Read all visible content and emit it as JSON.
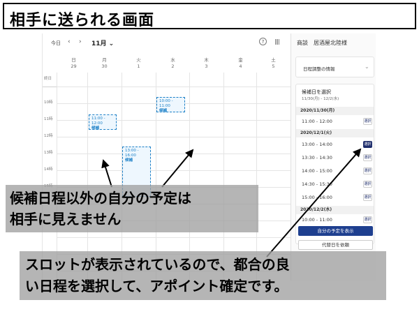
{
  "title": "相手に送られる画面",
  "calendar": {
    "today_label": "今日",
    "prev_icon": "‹",
    "next_icon": "›",
    "month_label": "11月 ⌄",
    "help_icon": "?",
    "view_icon": "||||",
    "days": [
      {
        "dow": "日",
        "date": "29"
      },
      {
        "dow": "月",
        "date": "30"
      },
      {
        "dow": "火",
        "date": "1"
      },
      {
        "dow": "水",
        "date": "2"
      },
      {
        "dow": "木",
        "date": "3"
      },
      {
        "dow": "金",
        "date": "4"
      },
      {
        "dow": "土",
        "date": "5"
      }
    ],
    "allday_label": "終日",
    "time_labels": [
      "10時",
      "11時",
      "12時",
      "13時",
      "14時",
      "15時"
    ],
    "events": [
      {
        "time": "11:00 - 12:00",
        "tag": "候補"
      },
      {
        "time": "10:00 - 11:00",
        "tag": "候補"
      },
      {
        "time": "13:00 - 16:00",
        "tag": "候補"
      }
    ]
  },
  "panel": {
    "title": "商談　居酒屋北陸様",
    "card1_label": "日程調整の情報",
    "card1_chevron": "⌄",
    "select_title": "候補日を選択",
    "range": "11/30(月) - 12/2(水)",
    "date1": "2020/11/30(月)",
    "date2": "2020/12/1(火)",
    "date3": "2020/12/2(水)",
    "slots": [
      "11:00 - 12:00",
      "13:00 - 14:00",
      "13:30 - 14:30",
      "14:00 - 15:00",
      "14:30 - 15:30",
      "15:00 - 16:00",
      "10:00 - 11:00"
    ],
    "select_label": "選択",
    "show_my_schedule": "自分の予定を表示",
    "request_alternate": "代替日を依頼"
  },
  "annotations": {
    "note1_line1": "候補日程以外の自分の予定は",
    "note1_line2": "相手に見えません",
    "note2_line1": "スロットが表示されているので、都合の良",
    "note2_line2": "い日程を選択して、アポイント確定です。"
  },
  "colors": {
    "accent": "#1e3f8f",
    "event_border": "#1a7fc7",
    "overlay": "#a0a0a0"
  }
}
